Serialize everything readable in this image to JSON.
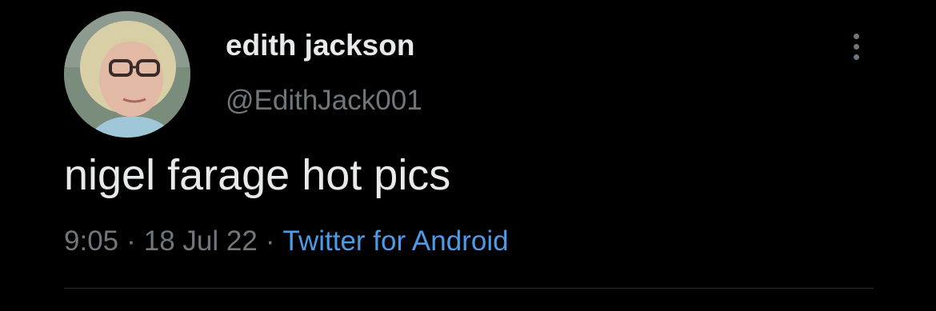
{
  "tweet": {
    "display_name": "edith jackson",
    "handle": "@EdithJack001",
    "text": "nigel farage hot pics",
    "time": "9:05",
    "separator": "·",
    "date": "18 Jul 22",
    "source": "Twitter for Android"
  },
  "icons": {
    "more": "more-vertical-icon",
    "avatar": "profile-photo"
  },
  "colors": {
    "background": "#000000",
    "primary_text": "#e7e9ea",
    "secondary_text": "#71767b",
    "link": "#4d9be6"
  }
}
